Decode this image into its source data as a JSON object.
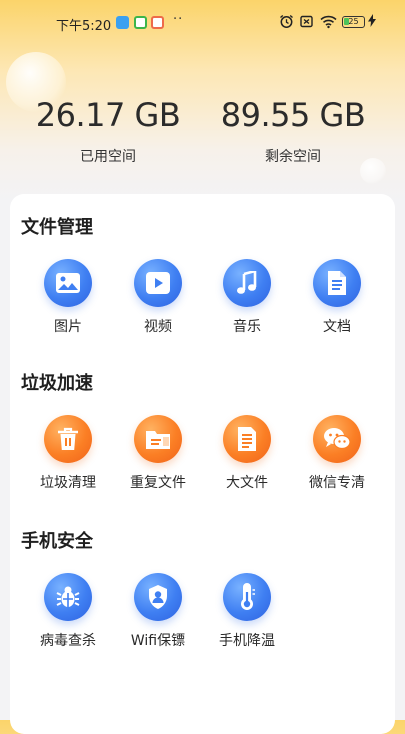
{
  "status_bar": {
    "time": "下午5:20",
    "dots": "··",
    "battery_level": 25,
    "battery_text": "25"
  },
  "storage": {
    "used_value": "26.17 GB",
    "used_label": "已用空间",
    "free_value": "89.55 GB",
    "free_label": "剩余空间"
  },
  "sections": {
    "file_management": {
      "title": "文件管理",
      "items": [
        {
          "label": "图片",
          "icon": "image-icon"
        },
        {
          "label": "视频",
          "icon": "video-icon"
        },
        {
          "label": "音乐",
          "icon": "music-icon"
        },
        {
          "label": "文档",
          "icon": "document-icon"
        }
      ]
    },
    "junk_acceleration": {
      "title": "垃圾加速",
      "items": [
        {
          "label": "垃圾清理",
          "icon": "trash-icon"
        },
        {
          "label": "重复文件",
          "icon": "duplicate-folder-icon"
        },
        {
          "label": "大文件",
          "icon": "large-file-icon"
        },
        {
          "label": "微信专清",
          "icon": "wechat-icon"
        }
      ]
    },
    "phone_security": {
      "title": "手机安全",
      "items": [
        {
          "label": "病毒查杀",
          "icon": "bug-icon"
        },
        {
          "label": "Wifi保镖",
          "icon": "shield-user-icon"
        },
        {
          "label": "手机降温",
          "icon": "thermometer-icon"
        }
      ]
    }
  },
  "colors": {
    "header_yellow": "#fbd46a",
    "icon_blue": "#3f7ff2",
    "icon_orange": "#fb7f25",
    "battery_green": "#4cc35a"
  }
}
